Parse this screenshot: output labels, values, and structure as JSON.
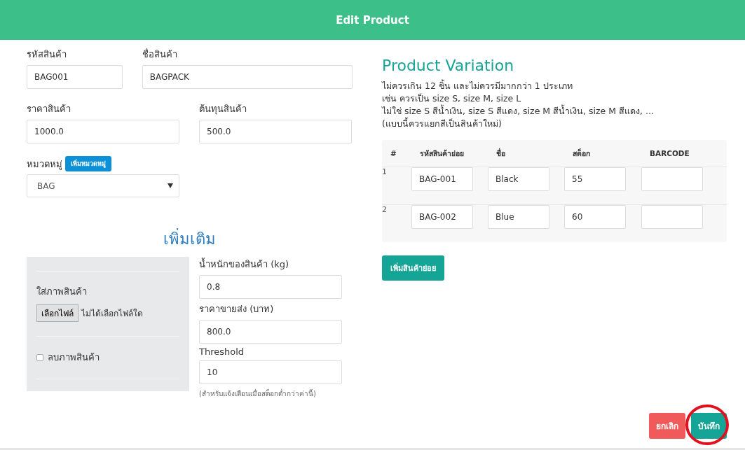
{
  "header": {
    "title": "Edit Product"
  },
  "basic": [
    {
      "label": "รหัสสินค้า",
      "value": "BAG001"
    },
    {
      "label": "ชื่อสินค้า",
      "value": "BAGPACK"
    },
    {
      "label": "ราคาสินค้า",
      "value": "1000.0"
    },
    {
      "label": "ต้นทุนสินค้า",
      "value": "500.0"
    }
  ],
  "category": {
    "label": "หมวดหมู่",
    "add_button": "เพิ่มหมวดหมู่",
    "value": "BAG"
  },
  "extra": {
    "title": "เพิ่มเติม",
    "image_label": "ใส่ภาพสินค้า",
    "file_button": "เลือกไฟล์",
    "file_status": "ไม่ได้เลือกไฟล์ใด",
    "delete_image": {
      "label": "ลบภาพสินค้า",
      "checked": false
    },
    "fields": [
      {
        "label": "น้ำหนักของสินค้า (kg)",
        "value": "0.8"
      },
      {
        "label": "ราคาขายส่ง (บาท)",
        "value": "800.0"
      },
      {
        "label": "Threshold",
        "value": "10"
      }
    ],
    "hint": "(สำหรับแจ้งเตือนเมื่อสต็อกต่ำกว่าค่านี้)"
  },
  "variation": {
    "title": "Product Variation",
    "notes": [
      "ไม่ควรเกิน 12 ชิ้น และไม่ควรมีมากกว่า 1 ประเภท",
      "เช่น ควรเป็น size S, size M, size L",
      "ไม่ใช่ size S สีน้ำเงิน, size S สีแดง, size M สีน้ำเงิน, size M สีแดง, ...",
      "(แบบนี้ควรแยกสีเป็นสินค้าใหม่)"
    ],
    "columns": [
      "#",
      "รหัสสินค้าย่อย",
      "ชื่อ",
      "สต็อก",
      "BARCODE"
    ],
    "rows": [
      {
        "index": "1",
        "sku": "BAG-001",
        "name": "Black",
        "stock": "55"
      },
      {
        "index": "2",
        "sku": "BAG-002",
        "name": "Blue",
        "stock": "60"
      }
    ],
    "add_button": "เพิ่มสินค้าย่อย"
  },
  "footer": {
    "cancel": "ยกเลิก",
    "save": "บันทึก",
    "save_circled": true
  }
}
